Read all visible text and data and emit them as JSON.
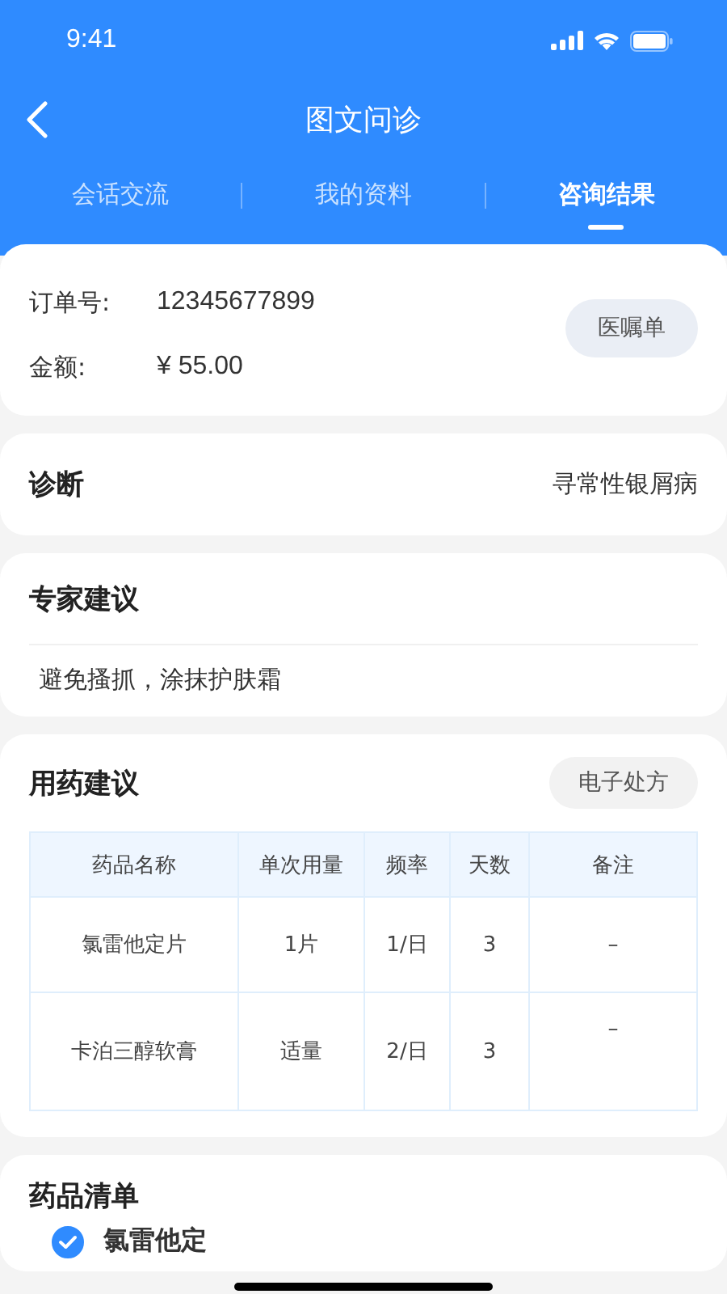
{
  "status_bar": {
    "time": "9:41"
  },
  "nav": {
    "title": "图文问诊"
  },
  "tabs": [
    {
      "label": "会话交流",
      "selected": false
    },
    {
      "label": "我的资料",
      "selected": false
    },
    {
      "label": "咨询结果",
      "selected": true
    }
  ],
  "order": {
    "number_label": "订单号:",
    "number": "12345677899",
    "amount_label": "金额:",
    "amount": "¥ 55.00",
    "button": "医嘱单"
  },
  "diagnosis": {
    "title": "诊断",
    "value": "寻常性银屑病"
  },
  "expert_advice": {
    "title": "专家建议",
    "text": "避免搔抓，涂抹护肤霜"
  },
  "medication": {
    "title": "用药建议",
    "button": "电子处方",
    "table": {
      "columns": [
        "药品名称",
        "单次用量",
        "频率",
        "天数",
        "备注"
      ],
      "rows": [
        {
          "cells": [
            "氯雷他定片",
            "1片",
            "1/日",
            "3",
            "–"
          ],
          "note_raised": false
        },
        {
          "cells": [
            "卡泊三醇软膏",
            "适量",
            "2/日",
            "3",
            "–"
          ],
          "note_raised": true
        }
      ]
    }
  },
  "drug_list": {
    "title": "药品清单",
    "items": [
      {
        "name": "氯雷他定",
        "checked": true
      }
    ]
  }
}
